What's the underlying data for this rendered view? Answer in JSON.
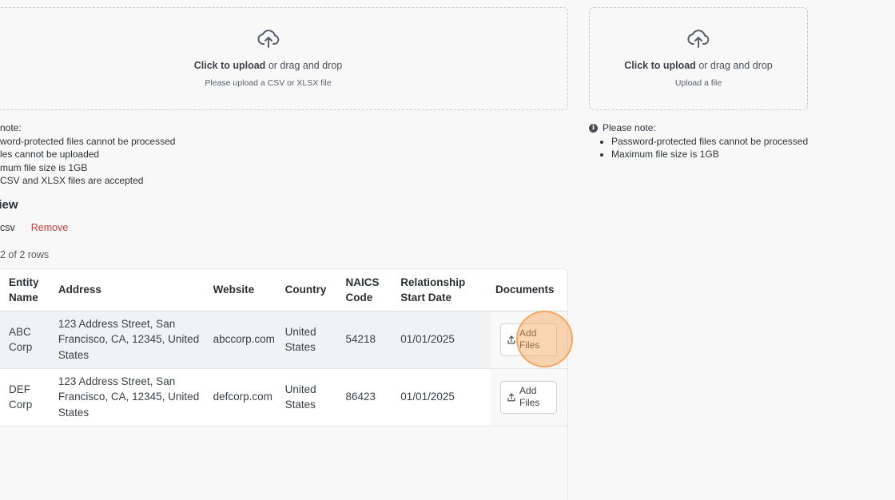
{
  "upload_primary": {
    "cta_bold": "Click to upload",
    "cta_rest": "or drag and drop",
    "hint": "Please upload a CSV or XLSX file",
    "icon": "cloud-upload-icon"
  },
  "upload_secondary": {
    "cta_bold": "Click to upload",
    "cta_rest": "or drag and drop",
    "hint": "Upload a file",
    "icon": "cloud-upload-icon"
  },
  "notes_primary": {
    "heading": "note:",
    "items": [
      "word-protected files cannot be processed",
      "les cannot be uploaded",
      "mum file size is 1GB",
      "CSV and XLSX files are accepted"
    ]
  },
  "notes_secondary": {
    "heading": "Please note:",
    "items": [
      "Password-protected files cannot be processed",
      "Maximum file size is 1GB"
    ]
  },
  "preview": {
    "title": "view",
    "file_name": "csv",
    "remove_label": "Remove",
    "row_count": "2 of 2 rows"
  },
  "table": {
    "headers": {
      "entity": "Entity Name",
      "address": "Address",
      "website": "Website",
      "country": "Country",
      "naics": "NAICS Code",
      "relationship": "Relationship Start Date",
      "documents": "Documents"
    },
    "rows": [
      {
        "entity": "ABC Corp",
        "address": "123 Address Street, San Francisco, CA, 12345, United States",
        "website": "abccorp.com",
        "country": "United States",
        "naics": "54218",
        "relationship": "01/01/2025",
        "button": "Add Files"
      },
      {
        "entity": "DEF Corp",
        "address": "123 Address Street, San Francisco, CA, 12345, United States",
        "website": "defcorp.com",
        "country": "United States",
        "naics": "86423",
        "relationship": "01/01/2025",
        "button": "Add Files"
      }
    ]
  },
  "colors": {
    "remove": "#cf3b36",
    "highlight": "#f7a454"
  }
}
